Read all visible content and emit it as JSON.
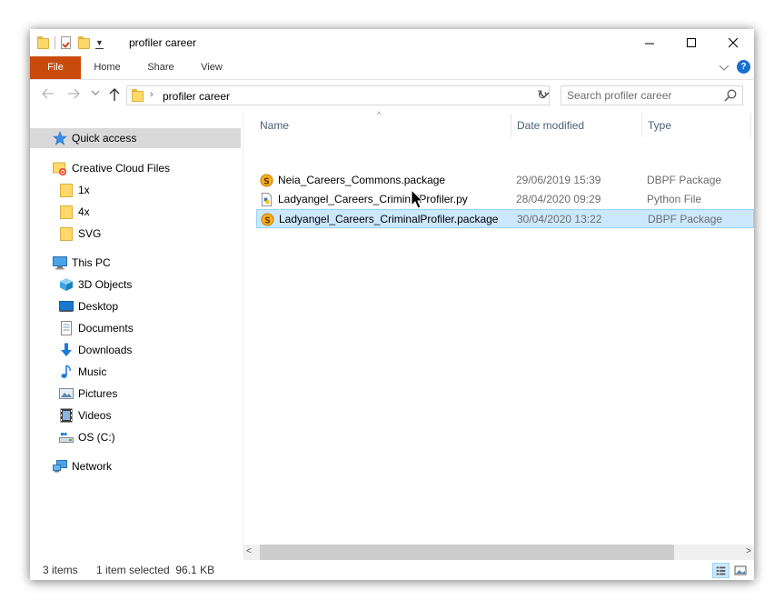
{
  "window": {
    "title": "profiler career",
    "controls": {
      "minimize": "—",
      "maximize": "☐",
      "close": "✕"
    }
  },
  "ribbon": {
    "tabs": [
      {
        "label": "File",
        "active": true,
        "color": "#c94b0c"
      },
      {
        "label": "Home"
      },
      {
        "label": "Share"
      },
      {
        "label": "View"
      }
    ],
    "help": "?"
  },
  "address": {
    "path": "profiler career",
    "search_placeholder": "Search profiler career"
  },
  "nav": {
    "items": [
      {
        "label": "Quick access",
        "icon": "star-icon",
        "selected": true
      },
      {
        "label": "Creative Cloud Files",
        "icon": "creative-cloud-folder-icon"
      },
      {
        "label": "1x",
        "icon": "folder-icon"
      },
      {
        "label": "4x",
        "icon": "folder-icon"
      },
      {
        "label": "SVG",
        "icon": "folder-icon"
      },
      {
        "label": "This PC",
        "icon": "computer-icon"
      },
      {
        "label": "3D Objects",
        "icon": "3d-objects-icon"
      },
      {
        "label": "Desktop",
        "icon": "desktop-icon"
      },
      {
        "label": "Documents",
        "icon": "documents-icon"
      },
      {
        "label": "Downloads",
        "icon": "downloads-icon"
      },
      {
        "label": "Music",
        "icon": "music-icon"
      },
      {
        "label": "Pictures",
        "icon": "pictures-icon"
      },
      {
        "label": "Videos",
        "icon": "videos-icon"
      },
      {
        "label": "OS (C:)",
        "icon": "drive-icon"
      },
      {
        "label": "Network",
        "icon": "network-icon"
      }
    ]
  },
  "columns": {
    "name": "Name",
    "date": "Date modified",
    "type": "Type"
  },
  "files": [
    {
      "name": "Neia_Careers_Commons.package",
      "date": "29/06/2019 15:39",
      "type": "DBPF Package",
      "icon": "sims-package-icon",
      "selected": false
    },
    {
      "name": "Ladyangel_Careers_CriminalProfiler.py",
      "date": "28/04/2020 09:29",
      "type": "Python File",
      "icon": "python-file-icon",
      "selected": false
    },
    {
      "name": "Ladyangel_Careers_CriminalProfiler.package",
      "date": "30/04/2020 13:22",
      "type": "DBPF Package",
      "icon": "sims-package-icon",
      "selected": true
    }
  ],
  "status": {
    "count": "3 items",
    "selection": "1 item selected  96.1 KB"
  },
  "colors": {
    "accent": "#c94b0c",
    "selection": "#cce8ff",
    "selection_border": "#99d1ff",
    "header_text": "#4c607a"
  }
}
